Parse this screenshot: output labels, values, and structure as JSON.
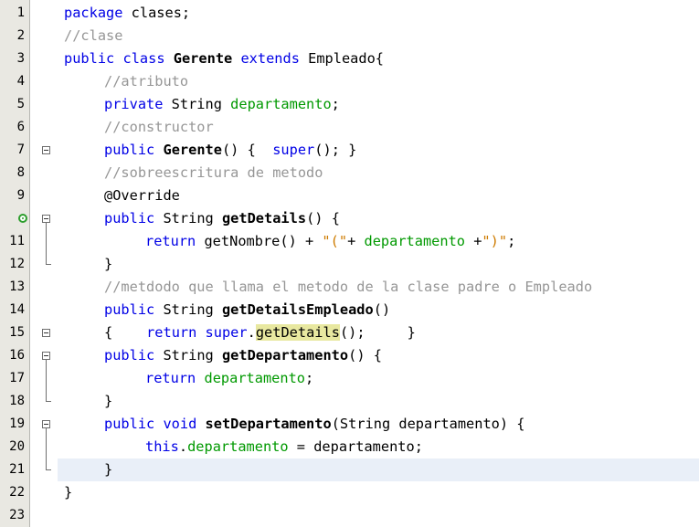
{
  "editor": {
    "line_numbers": [
      "1",
      "2",
      "3",
      "4",
      "5",
      "6",
      "7",
      "8",
      "9",
      "10",
      "11",
      "12",
      "13",
      "14",
      "15",
      "16",
      "17",
      "18",
      "19",
      "20",
      "21",
      "22",
      "23"
    ],
    "current_line": "21",
    "lines": {
      "l1": {
        "kw": "package",
        "rest": " clases;"
      },
      "l2": {
        "comment": "//clase"
      },
      "l3": {
        "kw1": "public",
        "kw2": "class",
        "name": "Gerente",
        "kw3": "extends",
        "rest": " Empleado{"
      },
      "l4": {
        "comment": "//atributo"
      },
      "l5": {
        "kw": "private",
        "type": " String ",
        "field": "departamento",
        "rest": ";"
      },
      "l6": {
        "comment": "//constructor"
      },
      "l7": {
        "kw": "public",
        "name": "Gerente",
        "mid": "() {  ",
        "kw2": "super",
        "rest": "(); }"
      },
      "l8": {
        "comment": "//sobreescritura de metodo"
      },
      "l9": {
        "annotation": "@Override"
      },
      "l10": {
        "kw": "public",
        "type": " String ",
        "name": "getDetails",
        "rest": "() {"
      },
      "l11": {
        "kw": "return",
        "a": " getNombre() + ",
        "s1": "\"(\"",
        "b": "+ ",
        "field": "departamento",
        "c": " +",
        "s2": "\")\"",
        "rest": ";"
      },
      "l12": {
        "text": "}"
      },
      "l13": {
        "comment": "//metdodo que llama el metodo de la clase padre o Empleado"
      },
      "l14": {
        "kw": "public",
        "type": " String ",
        "name": "getDetailsEmpleado",
        "rest": "()"
      },
      "l15": {
        "a": "{    ",
        "kw": "return",
        "b": " ",
        "kw2": "super",
        "c": ".",
        "hl": "getDetails",
        "rest": "();     }"
      },
      "l16": {
        "kw": "public",
        "type": " String ",
        "name": "getDepartamento",
        "rest": "() {"
      },
      "l17": {
        "kw": "return",
        "b": " ",
        "field": "departamento",
        "rest": ";"
      },
      "l18": {
        "text": "}"
      },
      "l19": {
        "kw": "public",
        "kw2": " void ",
        "name": "setDepartamento",
        "rest": "(String departamento) {"
      },
      "l20": {
        "kw": "this",
        "b": ".",
        "field": "departamento",
        "rest": " = departamento;"
      },
      "l21": {
        "text": "}"
      },
      "l22": {
        "text": "}"
      },
      "l23": {
        "text": ""
      }
    }
  },
  "colors": {
    "keyword": "#0000e6",
    "comment": "#969696",
    "field": "#009900",
    "string": "#ce7b00",
    "gutter": "#e9e8e2",
    "current_line": "#e9eff8",
    "highlight": "#e8e8a0"
  },
  "icons": {
    "fold": "minus-box-icon",
    "override": "override-marker-icon"
  }
}
